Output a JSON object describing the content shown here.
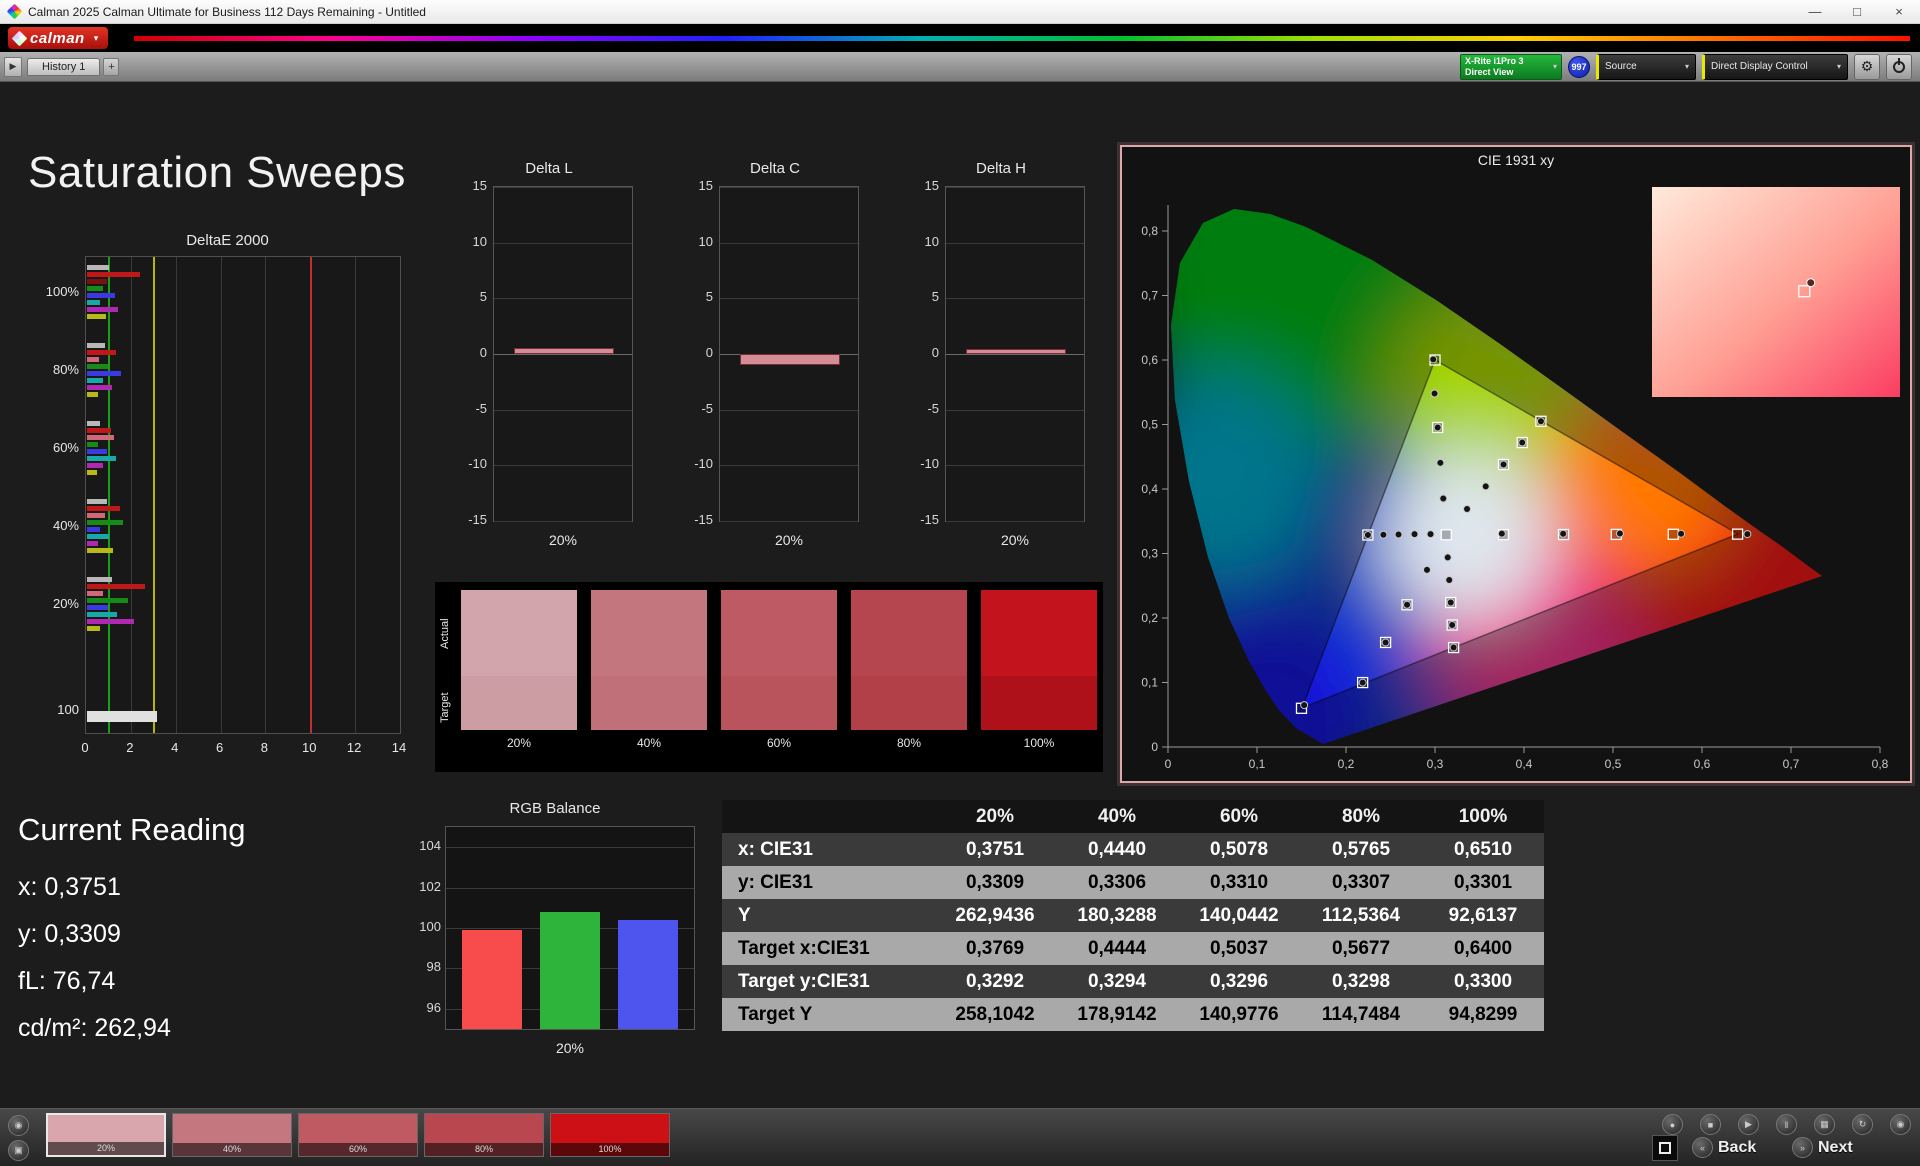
{
  "window": {
    "title": "Calman 2025 Calman Ultimate for Business 112 Days Remaining  - Untitled",
    "icons": {
      "minimize": "—",
      "maximize": "□",
      "close": "×"
    }
  },
  "brand": {
    "name": "calman"
  },
  "toolbar": {
    "expand_icon": "▶",
    "history_tab": "History 1",
    "add_icon": "+",
    "meter": {
      "line1": "X-Rite i1Pro 3",
      "line2": "Direct View"
    },
    "badge": "997",
    "source": "Source",
    "display_control": "Direct Display Control",
    "dropdown_icon": "▾",
    "gear_icon": "⚙"
  },
  "page": {
    "title": "Saturation Sweeps"
  },
  "current_reading": {
    "title": "Current Reading",
    "x": "x: 0,3751",
    "y": "y: 0,3309",
    "fl": "fL: 76,74",
    "cd": "cd/m²: 262,94"
  },
  "comparison": {
    "actual_label": "Actual",
    "target_label": "Target",
    "columns": [
      {
        "label": "20%",
        "actual": "#d2a4ab",
        "target": "#cd9da4"
      },
      {
        "label": "40%",
        "actual": "#c4767f",
        "target": "#c07079"
      },
      {
        "label": "60%",
        "actual": "#bd5a63",
        "target": "#b9545d"
      },
      {
        "label": "80%",
        "actual": "#b5464f",
        "target": "#b24049"
      },
      {
        "label": "100%",
        "actual": "#c3141d",
        "target": "#ae1119"
      }
    ]
  },
  "chart_data": {
    "deltae": {
      "type": "bar",
      "orientation": "horizontal",
      "title": "DeltaE 2000",
      "xlim": [
        0,
        14
      ],
      "x_ticks": [
        0,
        2,
        4,
        6,
        8,
        10,
        12,
        14
      ],
      "ref_lines": [
        {
          "value": 1,
          "color": "#18a018"
        },
        {
          "value": 3,
          "color": "#b6b800"
        },
        {
          "value": 10,
          "color": "#c03030"
        }
      ],
      "groups": [
        {
          "label": "100%",
          "bars": [
            {
              "v": 1.0,
              "c": "#b8b8b8"
            },
            {
              "v": 2.35,
              "c": "#c01818"
            },
            {
              "v": 0.9,
              "c": "#7a1010"
            },
            {
              "v": 0.7,
              "c": "#188a18"
            },
            {
              "v": 1.25,
              "c": "#3a3ae0"
            },
            {
              "v": 0.6,
              "c": "#18a8a8"
            },
            {
              "v": 1.4,
              "c": "#b028b0"
            },
            {
              "v": 0.85,
              "c": "#b8b818"
            }
          ]
        },
        {
          "label": "80%",
          "bars": [
            {
              "v": 0.8,
              "c": "#b8b8b8"
            },
            {
              "v": 1.3,
              "c": "#c01818"
            },
            {
              "v": 0.55,
              "c": "#d06878"
            },
            {
              "v": 0.95,
              "c": "#188a18"
            },
            {
              "v": 1.5,
              "c": "#3a3ae0"
            },
            {
              "v": 0.7,
              "c": "#18a8a8"
            },
            {
              "v": 1.1,
              "c": "#b028b0"
            },
            {
              "v": 0.5,
              "c": "#b8b818"
            }
          ]
        },
        {
          "label": "60%",
          "bars": [
            {
              "v": 0.6,
              "c": "#b8b8b8"
            },
            {
              "v": 1.05,
              "c": "#c01818"
            },
            {
              "v": 1.2,
              "c": "#d06878"
            },
            {
              "v": 0.5,
              "c": "#188a18"
            },
            {
              "v": 0.9,
              "c": "#3a3ae0"
            },
            {
              "v": 1.3,
              "c": "#18a8a8"
            },
            {
              "v": 0.7,
              "c": "#b028b0"
            },
            {
              "v": 0.45,
              "c": "#b8b818"
            }
          ]
        },
        {
          "label": "40%",
          "bars": [
            {
              "v": 0.9,
              "c": "#b8b8b8"
            },
            {
              "v": 1.45,
              "c": "#c01818"
            },
            {
              "v": 0.8,
              "c": "#d06878"
            },
            {
              "v": 1.6,
              "c": "#188a18"
            },
            {
              "v": 0.6,
              "c": "#3a3ae0"
            },
            {
              "v": 1.0,
              "c": "#18a8a8"
            },
            {
              "v": 0.5,
              "c": "#b028b0"
            },
            {
              "v": 1.15,
              "c": "#b8b818"
            }
          ]
        },
        {
          "label": "20%",
          "bars": [
            {
              "v": 1.1,
              "c": "#b8b8b8"
            },
            {
              "v": 2.6,
              "c": "#c01818"
            },
            {
              "v": 0.7,
              "c": "#d06878"
            },
            {
              "v": 1.85,
              "c": "#188a18"
            },
            {
              "v": 0.95,
              "c": "#3a3ae0"
            },
            {
              "v": 1.35,
              "c": "#18a8a8"
            },
            {
              "v": 2.1,
              "c": "#b028b0"
            },
            {
              "v": 0.6,
              "c": "#b8b818"
            }
          ]
        },
        {
          "label": "100",
          "bars": [
            {
              "v": 3.1,
              "c": "#e0e0e0",
              "tall": true
            }
          ]
        }
      ]
    },
    "delta_l": {
      "type": "bar",
      "title": "Delta L",
      "categories": [
        "20%"
      ],
      "values": [
        0.5
      ],
      "ylim": [
        -15,
        15
      ],
      "y_ticks": [
        15,
        10,
        5,
        0,
        -5,
        -10,
        -15
      ],
      "bar_color": "#d28d96",
      "bar_border": "#7e2a33"
    },
    "delta_c": {
      "type": "bar",
      "title": "Delta C",
      "categories": [
        "20%"
      ],
      "values": [
        -1.0
      ],
      "ylim": [
        -15,
        15
      ],
      "y_ticks": [
        15,
        10,
        5,
        0,
        -5,
        -10,
        -15
      ],
      "bar_color": "#d28d96",
      "bar_border": "#7e2a33"
    },
    "delta_h": {
      "type": "bar",
      "title": "Delta H",
      "categories": [
        "20%"
      ],
      "values": [
        0.45
      ],
      "ylim": [
        -15,
        15
      ],
      "y_ticks": [
        15,
        10,
        5,
        0,
        -5,
        -10,
        -15
      ],
      "bar_color": "#d28d96",
      "bar_border": "#7e2a33"
    },
    "rgb_balance": {
      "type": "bar",
      "title": "RGB Balance",
      "xlabel": "20%",
      "ylim": [
        95,
        105
      ],
      "y_ticks": [
        104,
        102,
        100,
        98,
        96
      ],
      "series": [
        {
          "name": "Red",
          "value": 99.9,
          "color": "#f84b4b"
        },
        {
          "name": "Green",
          "value": 100.8,
          "color": "#2eb43a"
        },
        {
          "name": "Blue",
          "value": 100.4,
          "color": "#4d55ee"
        }
      ]
    },
    "cie": {
      "type": "scatter",
      "title": "CIE 1931 xy",
      "xlim": [
        0,
        0.8
      ],
      "ylim": [
        0,
        0.84
      ],
      "x_tick_labels": [
        "0",
        "0,1",
        "0,2",
        "0,3",
        "0,4",
        "0,5",
        "0,6",
        "0,7",
        "0,8"
      ],
      "y_tick_labels": [
        "0",
        "0,1",
        "0,2",
        "0,3",
        "0,4",
        "0,5",
        "0,6",
        "0,7",
        "0,8"
      ],
      "targets": [
        [
          0.3769,
          0.3292
        ],
        [
          0.4444,
          0.3294
        ],
        [
          0.5037,
          0.3296
        ],
        [
          0.5677,
          0.3298
        ],
        [
          0.64,
          0.33
        ],
        [
          0.303,
          0.4954
        ],
        [
          0.3,
          0.6
        ],
        [
          0.377,
          0.438
        ],
        [
          0.398,
          0.472
        ],
        [
          0.419,
          0.505
        ],
        [
          0.2686,
          0.2205
        ],
        [
          0.2445,
          0.1621
        ],
        [
          0.2187,
          0.0999
        ],
        [
          0.15,
          0.06
        ],
        [
          0.3177,
          0.224
        ],
        [
          0.3193,
          0.1891
        ],
        [
          0.3209,
          0.1542
        ],
        [
          0.2246,
          0.3287
        ],
        [
          0.3127,
          0.329
        ]
      ],
      "measured": [
        [
          0.3751,
          0.3309
        ],
        [
          0.444,
          0.3306
        ],
        [
          0.5078,
          0.331
        ],
        [
          0.5765,
          0.3307
        ],
        [
          0.651,
          0.3301
        ],
        [
          0.3093,
          0.3852
        ],
        [
          0.306,
          0.4406
        ],
        [
          0.303,
          0.4954
        ],
        [
          0.2995,
          0.548
        ],
        [
          0.298,
          0.601
        ],
        [
          0.336,
          0.369
        ],
        [
          0.357,
          0.404
        ],
        [
          0.377,
          0.438
        ],
        [
          0.398,
          0.472
        ],
        [
          0.419,
          0.505
        ],
        [
          0.291,
          0.2747
        ],
        [
          0.2686,
          0.2205
        ],
        [
          0.2445,
          0.1621
        ],
        [
          0.2187,
          0.0999
        ],
        [
          0.153,
          0.065
        ],
        [
          0.3143,
          0.2939
        ],
        [
          0.316,
          0.259
        ],
        [
          0.3177,
          0.224
        ],
        [
          0.3193,
          0.1891
        ],
        [
          0.3209,
          0.1542
        ],
        [
          0.295,
          0.33
        ],
        [
          0.277,
          0.33
        ],
        [
          0.259,
          0.3295
        ],
        [
          0.242,
          0.329
        ],
        [
          0.2246,
          0.3287
        ]
      ],
      "inset_marker": [
        0.62,
        0.47
      ]
    },
    "table": {
      "headers": [
        "",
        "20%",
        "40%",
        "60%",
        "80%",
        "100%"
      ],
      "rows": [
        {
          "label": "x: CIE31",
          "shade": "dark",
          "values": [
            "0,3751",
            "0,4440",
            "0,5078",
            "0,5765",
            "0,6510"
          ]
        },
        {
          "label": "y: CIE31",
          "shade": "light",
          "values": [
            "0,3309",
            "0,3306",
            "0,3310",
            "0,3307",
            "0,3301"
          ]
        },
        {
          "label": "Y",
          "shade": "dark",
          "values": [
            "262,9436",
            "180,3288",
            "140,0442",
            "112,5364",
            "92,6137"
          ]
        },
        {
          "label": "Target x:CIE31",
          "shade": "light",
          "values": [
            "0,3769",
            "0,4444",
            "0,5037",
            "0,5677",
            "0,6400"
          ]
        },
        {
          "label": "Target y:CIE31",
          "shade": "dark",
          "values": [
            "0,3292",
            "0,3294",
            "0,3296",
            "0,3298",
            "0,3300"
          ]
        },
        {
          "label": "Target Y",
          "shade": "light",
          "values": [
            "258,1042",
            "178,9142",
            "140,9776",
            "114,7484",
            "94,8299"
          ]
        }
      ]
    }
  },
  "bottom": {
    "swatches": [
      {
        "label": "20%",
        "color": "#d8a6ac",
        "selected": true
      },
      {
        "label": "40%",
        "color": "#c57780"
      },
      {
        "label": "60%",
        "color": "#bf5a62"
      },
      {
        "label": "80%",
        "color": "#b8474f"
      },
      {
        "label": "100%",
        "color": "#cd1016"
      }
    ],
    "tool_icons": [
      {
        "name": "record",
        "glyph": "●"
      },
      {
        "name": "stop",
        "glyph": "■"
      },
      {
        "name": "play",
        "glyph": "▶"
      },
      {
        "name": "pause",
        "glyph": "‖"
      },
      {
        "name": "grid",
        "glyph": "▦"
      },
      {
        "name": "refresh",
        "glyph": "↻"
      },
      {
        "name": "target",
        "glyph": "◉"
      }
    ],
    "back_label": "Back",
    "next_label": "Next",
    "back_icon": "«",
    "next_icon": "»",
    "camera_icon": "◉",
    "layers_icon": "▣"
  }
}
